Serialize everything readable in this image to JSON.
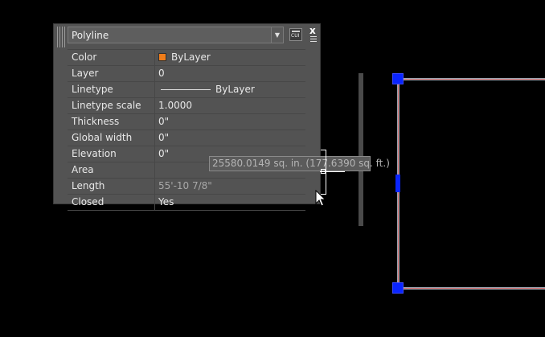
{
  "palette": {
    "object_type": "Polyline",
    "cui_label": "CUI",
    "close_label": "x",
    "rows": [
      {
        "name": "Color",
        "value": "ByLayer",
        "kind": "color",
        "swatch": "#f07d1a"
      },
      {
        "name": "Layer",
        "value": "0"
      },
      {
        "name": "Linetype",
        "value": "ByLayer",
        "kind": "linetype"
      },
      {
        "name": "Linetype scale",
        "value": "1.0000"
      },
      {
        "name": "Thickness",
        "value": "0\""
      },
      {
        "name": "Global width",
        "value": "0\""
      },
      {
        "name": "Elevation",
        "value": "0\""
      },
      {
        "name": "Area",
        "value": "25580.0149 sq. in. (177.6390 sq. ft.)",
        "readonly": true
      },
      {
        "name": "Length",
        "value": "55'-10 7/8\"",
        "readonly": true
      },
      {
        "name": "Closed",
        "value": "Yes"
      }
    ]
  },
  "tooltip": {
    "text": "25580.0149 sq. in. (177.6390 sq. ft.)"
  },
  "colors": {
    "grip": "#0a25ff",
    "polyline": "#d46e6e",
    "swatch": "#f07d1a"
  }
}
